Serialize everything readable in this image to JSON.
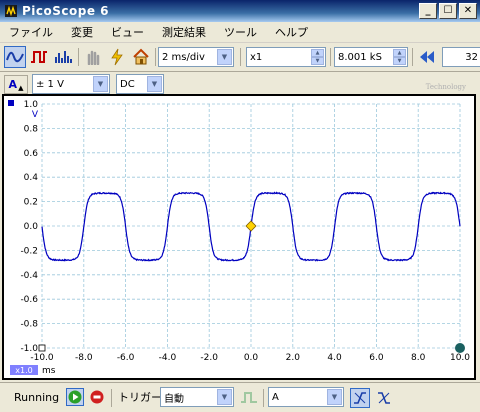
{
  "window": {
    "title": "PicoScope  6"
  },
  "menu": [
    "ファイル",
    "変更",
    "ビュー",
    "測定結果",
    "ツール",
    "ヘルプ"
  ],
  "toolbar": {
    "timebase": "2 ms/div",
    "zoom": "x1",
    "sample_count": "8.001 kS",
    "captures": "32"
  },
  "channel": {
    "label": "A",
    "range": "± 1  V",
    "coupling": "DC"
  },
  "watermark": "Technology",
  "status": {
    "state": "Running",
    "trigger_label": "トリガー",
    "trigger_mode": "自動",
    "trigger_channel": "A"
  },
  "chart_data": {
    "type": "line",
    "title": "",
    "xlabel": "ms",
    "ylabel": "V",
    "xlim": [
      -10.0,
      10.0
    ],
    "ylim": [
      -1.0,
      1.0
    ],
    "x_ticks": [
      "-10.0",
      "-8.0",
      "-6.0",
      "-4.0",
      "-2.0",
      "0.0",
      "2.0",
      "4.0",
      "6.0",
      "8.0",
      "10.0"
    ],
    "y_ticks": [
      "1.0",
      "0.8",
      "0.6",
      "0.4",
      "0.2",
      "0.0",
      "-0.2",
      "-0.4",
      "-0.6",
      "-0.8",
      "-1.0"
    ],
    "x_zoom_label": "x1.0",
    "grid": true,
    "trigger_point": {
      "x": 0.0,
      "y": 0.0
    },
    "series": [
      {
        "color": "#0000c0",
        "signal": "rounded square wave",
        "period_ms": 4.0,
        "high_v": 0.27,
        "low_v": -0.28,
        "rising_zero_crossings_ms": [
          -8.0,
          -4.0,
          0.0,
          4.0,
          8.0
        ]
      }
    ]
  },
  "colors": {
    "trace": "#0000c0",
    "grid": "#9cc8dc",
    "titlebar": "#0a246a"
  }
}
